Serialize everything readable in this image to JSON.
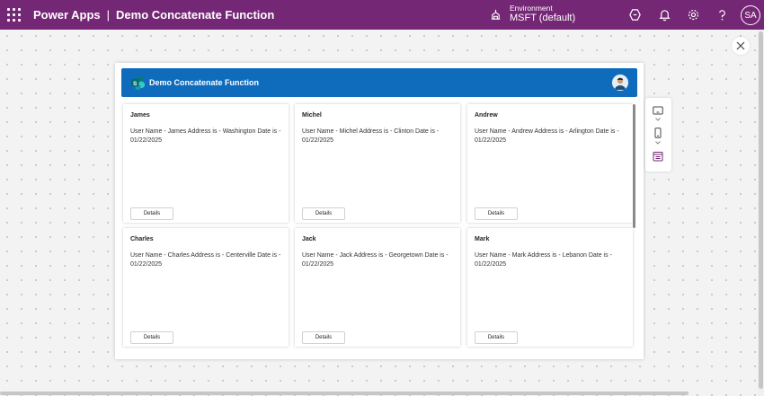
{
  "topbar": {
    "app_name": "Power Apps",
    "separator": "|",
    "app_title": "Demo Concatenate Function",
    "environment_label": "Environment",
    "environment_value": "MSFT (default)",
    "user_initials": "SA",
    "icons": [
      "waffle-icon",
      "environment-icon",
      "copilot-icon",
      "bell-icon",
      "gear-icon",
      "help-icon"
    ]
  },
  "app": {
    "header_title": "Demo Concatenate Function",
    "cards": [
      {
        "name": "James",
        "desc": "User Name - James  Address is - Washington  Date is - 01/22/2025",
        "button": "Details"
      },
      {
        "name": "Michel",
        "desc": "User Name - Michel  Address is - Clinton  Date is - 01/22/2025",
        "button": "Details"
      },
      {
        "name": "Andrew",
        "desc": "User Name - Andrew  Address is - Arlington  Date is - 01/22/2025",
        "button": "Details"
      },
      {
        "name": "Charles",
        "desc": "User Name - Charles  Address is - Centerville  Date is - 01/22/2025",
        "button": "Details"
      },
      {
        "name": "Jack",
        "desc": "User Name - Jack  Address is - Georgetown  Date is - 01/22/2025",
        "button": "Details"
      },
      {
        "name": "Mark",
        "desc": "User Name - Mark  Address is - Lebanon  Date is - 01/22/2025",
        "button": "Details"
      }
    ]
  },
  "colors": {
    "topbar": "#742774",
    "header": "#0f6cbd"
  }
}
